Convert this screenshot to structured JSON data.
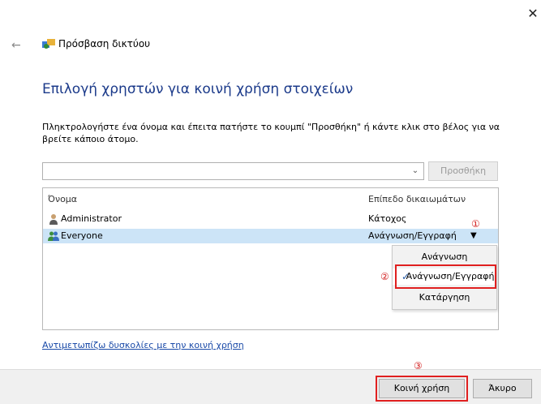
{
  "window": {
    "title": "Πρόσβαση δικτύου",
    "close_glyph": "✕",
    "back_glyph": "←"
  },
  "page": {
    "heading": "Επιλογή χρηστών για κοινή χρήση στοιχείων",
    "instructions": "Πληκτρολογήστε ένα όνομα και έπειτα πατήστε το κουμπί \"Προσθήκη\" ή κάντε κλικ στο βέλος για να βρείτε κάποιο άτομο."
  },
  "user_picker": {
    "value": "",
    "arrow_glyph": "⌄",
    "add_label": "Προσθήκη"
  },
  "table": {
    "col_name": "Όνομα",
    "col_permission": "Επίπεδο δικαιωμάτων",
    "rows": [
      {
        "name": "Administrator",
        "permission": "Κάτοχος",
        "icon": "user-icon"
      },
      {
        "name": "Everyone",
        "permission": "Ανάγνωση/Εγγραφή",
        "icon": "group-icon",
        "selected": true
      }
    ],
    "dropdown_glyph": "▼"
  },
  "permission_menu": {
    "items": [
      "Ανάγνωση",
      "Ανάγνωση/Εγγραφή",
      "Κατάργηση"
    ],
    "selected_index": 1,
    "check_glyph": "✓"
  },
  "annotations": {
    "step1": "①",
    "step2": "②",
    "step3": "③",
    "color": "#e02020"
  },
  "help_link": "Αντιμετωπίζω δυσκολίες με την κοινή χρήση",
  "footer": {
    "share_label": "Κοινή χρήση",
    "cancel_label": "Άκυρο"
  },
  "colors": {
    "heading": "#1b3a8a",
    "selection": "#cce4f7",
    "link": "#1a4aa8"
  }
}
